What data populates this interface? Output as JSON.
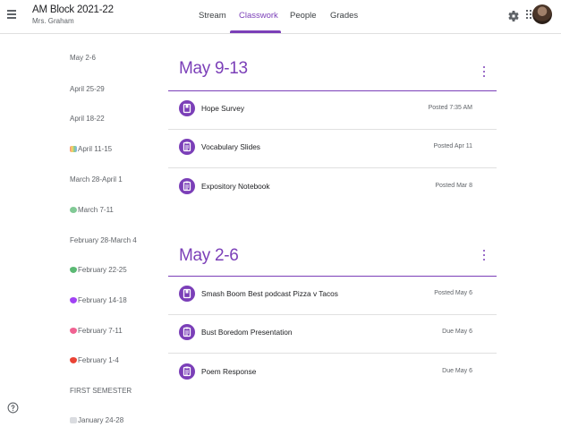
{
  "header": {
    "class_name": "AM Block 2021-22",
    "teacher": "Mrs. Graham",
    "tabs": [
      {
        "label": "Stream"
      },
      {
        "label": "Classwork"
      },
      {
        "label": "People"
      },
      {
        "label": "Grades"
      }
    ],
    "active_tab": "Classwork"
  },
  "sidebar": {
    "items": [
      {
        "label": "May 2-6"
      },
      {
        "label": "April 25-29"
      },
      {
        "label": "April 18-22"
      },
      {
        "label": "April 11-15",
        "emoji": "rainbow-cloud"
      },
      {
        "label": "March 28-April 1"
      },
      {
        "label": "March 7-11",
        "emoji": "clover"
      },
      {
        "label": "February 28-March 4"
      },
      {
        "label": "February 22-25",
        "emoji": "green-heart"
      },
      {
        "label": "February 14-18",
        "emoji": "purple-heart"
      },
      {
        "label": "February 7-11",
        "emoji": "cupid-heart"
      },
      {
        "label": "February 1-4",
        "emoji": "red-heart"
      },
      {
        "label": "FIRST SEMESTER"
      },
      {
        "label": "January 24-28",
        "emoji": "calendar"
      }
    ]
  },
  "topics": [
    {
      "title": "May 9-13",
      "items": [
        {
          "title": "Hope Survey",
          "meta": "Posted 7:35 AM",
          "icon": "form-icon"
        },
        {
          "title": "Vocabulary Slides",
          "meta": "Posted Apr 11",
          "icon": "assignment-icon"
        },
        {
          "title": "Expository Notebook",
          "meta": "Posted Mar 8",
          "icon": "assignment-icon"
        }
      ]
    },
    {
      "title": "May 2-6",
      "items": [
        {
          "title": "Smash Boom Best podcast Pizza v Tacos",
          "meta": "Posted May 6",
          "icon": "form-icon"
        },
        {
          "title": "Bust Boredom Presentation",
          "meta": "Due May 6",
          "icon": "assignment-icon"
        },
        {
          "title": "Poem Response",
          "meta": "Due May 6",
          "icon": "assignment-icon"
        }
      ]
    }
  ],
  "colors": {
    "accent": "#7b3fb8",
    "divider": "#e0e0e0",
    "text": "#202124",
    "muted": "#5f6368"
  }
}
